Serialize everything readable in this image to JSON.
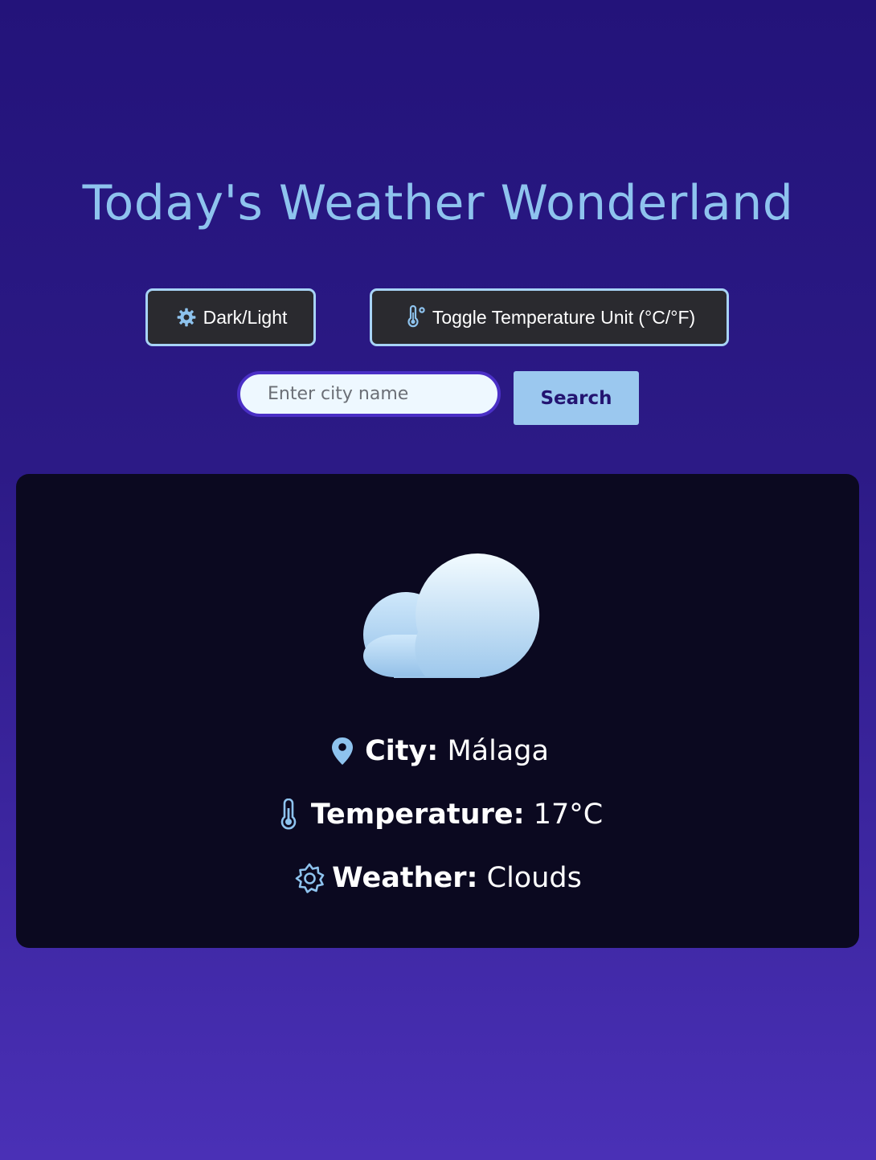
{
  "page": {
    "title": "Today's Weather Wonderland"
  },
  "controls": {
    "theme_button_label": "Dark/Light",
    "theme_button_icon": "gear-icon",
    "unit_button_label": "Toggle Temperature Unit (°C/°F)",
    "unit_button_icon": "thermometer-degree-icon"
  },
  "search": {
    "placeholder": "Enter city name",
    "value": "",
    "button_label": "Search"
  },
  "weather": {
    "condition_icon": "cloud-icon",
    "city_label": "City:",
    "city_value": "Málaga",
    "temperature_label": "Temperature:",
    "temperature_value": "17°C",
    "weather_label": "Weather:",
    "weather_value": "Clouds"
  },
  "colors": {
    "accent": "#8ec3ee",
    "background_top": "#23137a",
    "background_bottom": "#4a30b6",
    "card": "#0b0920",
    "button_border": "#a7d3f6",
    "search_button": "#9bc8ef"
  }
}
